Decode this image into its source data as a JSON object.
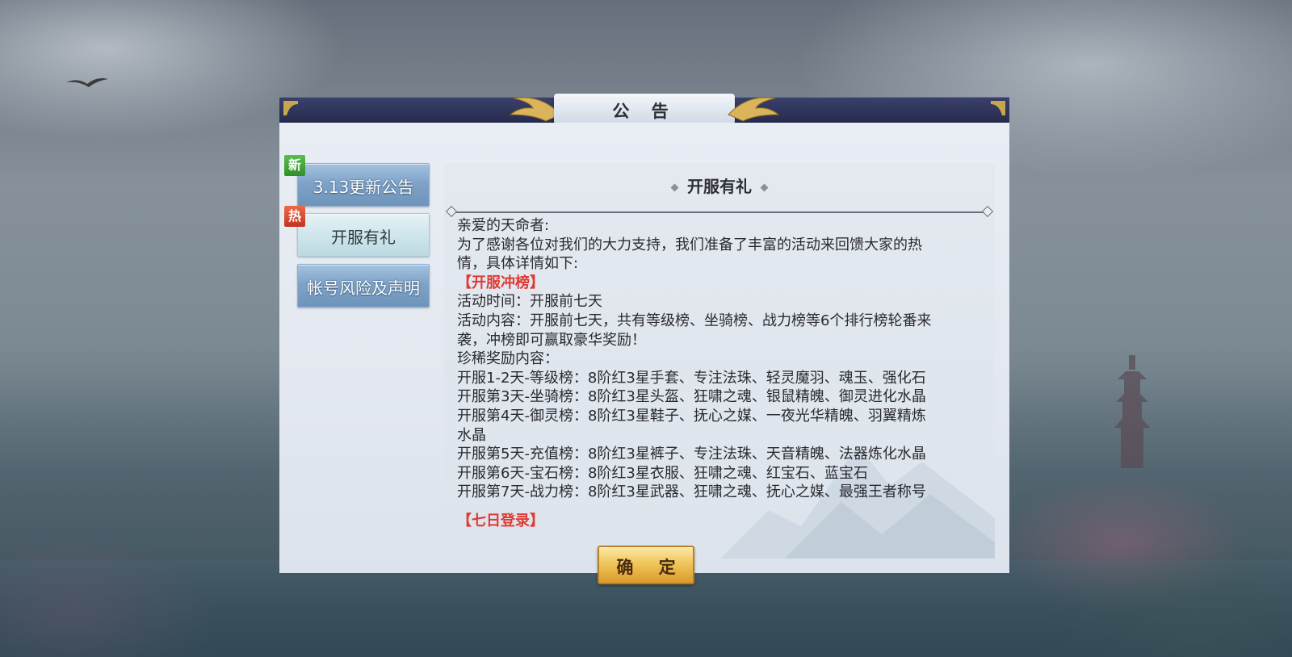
{
  "dialog": {
    "title": "公  告",
    "confirm_label": "确 定"
  },
  "tabs": [
    {
      "label": "3.13更新公告",
      "badge": "新",
      "active": false
    },
    {
      "label": "开服有礼",
      "badge": "热",
      "active": true
    },
    {
      "label": "帐号风险及声明",
      "badge": "",
      "active": false
    }
  ],
  "content": {
    "title": "开服有礼",
    "lines": [
      {
        "text": "亲爱的天命者:",
        "style": "normal"
      },
      {
        "text": "为了感谢各位对我们的大力支持，我们准备了丰富的活动来回馈大家的热",
        "style": "normal"
      },
      {
        "text": "情，具体详情如下:",
        "style": "normal"
      },
      {
        "text": "【开服冲榜】",
        "style": "red"
      },
      {
        "text": "活动时间：开服前七天",
        "style": "normal"
      },
      {
        "text": "活动内容：开服前七天，共有等级榜、坐骑榜、战力榜等6个排行榜轮番来",
        "style": "normal"
      },
      {
        "text": "袭，冲榜即可赢取豪华奖励！",
        "style": "normal"
      },
      {
        "text": "珍稀奖励内容：",
        "style": "normal"
      },
      {
        "text": "开服1-2天-等级榜：8阶红3星手套、专注法珠、轻灵魔羽、魂玉、强化石",
        "style": "normal"
      },
      {
        "text": "开服第3天-坐骑榜：8阶红3星头盔、狂啸之魂、银鼠精魄、御灵进化水晶",
        "style": "normal"
      },
      {
        "text": "开服第4天-御灵榜：8阶红3星鞋子、抚心之媒、一夜光华精魄、羽翼精炼",
        "style": "normal"
      },
      {
        "text": "水晶",
        "style": "normal"
      },
      {
        "text": "开服第5天-充值榜：8阶红3星裤子、专注法珠、天音精魄、法器炼化水晶",
        "style": "normal"
      },
      {
        "text": "开服第6天-宝石榜：8阶红3星衣服、狂啸之魂、红宝石、蓝宝石",
        "style": "normal"
      },
      {
        "text": "开服第7天-战力榜：8阶红3星武器、狂啸之魂、抚心之媒、最强王者称号",
        "style": "normal"
      },
      {
        "text": "【七日登录】",
        "style": "red-gap"
      }
    ]
  },
  "colors": {
    "header": "#262b4c",
    "highlight_red": "#e03a34",
    "tab_blue": "#7fa3c8",
    "confirm_gold": "#f0c65b"
  }
}
